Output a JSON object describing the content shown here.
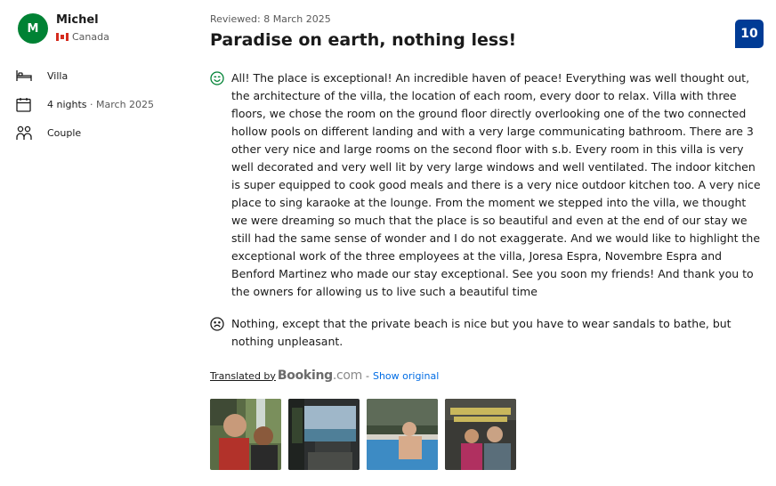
{
  "reviewer": {
    "initial": "M",
    "name": "Michel",
    "country": "Canada"
  },
  "stay": {
    "room": "Villa",
    "nights": "4 nights",
    "date": "March 2025",
    "traveler_type": "Couple"
  },
  "review": {
    "reviewed_date": "Reviewed: 8 March 2025",
    "title": "Paradise on earth, nothing less!",
    "score": "10",
    "positive": "All! The place is exceptional! An incredible haven of peace! Everything was well thought out, the architecture of the villa, the location of each room, every door to relax. Villa with three floors, we chose the room on the ground floor directly overlooking one of the two connected hollow pools on different landing and with a very large communicating bathroom. There are 3 other very nice and large rooms on the second floor with s.b. Every room in this villa is very well decorated and very well lit by very large windows and well ventilated. The indoor kitchen is super equipped to cook good meals and there is a very nice outdoor kitchen too. A very nice place to sing karaoke at the lounge. From the moment we stepped into the villa, we thought we were dreaming so much that the place is so beautiful and even at the end of our stay we still had the same sense of wonder and I do not exaggerate. And we would like to highlight the exceptional work of the three employees at the villa, Joresa Espra, Novembre Espra and Benford Martinez who made our stay exceptional. See you soon my friends! And thank you to the owners for allowing us to live such a beautiful time",
    "negative": "Nothing, except that the private beach is nice but you have to wear sandals to bathe, but nothing unpleasant."
  },
  "translation": {
    "translated_by": "Translated by",
    "brand": "Booking",
    "brand_suffix": ".com",
    "separator": "-",
    "show_original": "Show original"
  },
  "photos": [
    {
      "icon": "photo-selfie-waterfall"
    },
    {
      "icon": "photo-sea-view-terrace"
    },
    {
      "icon": "photo-pool-swimmer"
    },
    {
      "icon": "photo-villa-sign-couple"
    }
  ],
  "colors": {
    "avatar": "#008234",
    "score_badge": "#003b95",
    "link": "#006ce4"
  }
}
